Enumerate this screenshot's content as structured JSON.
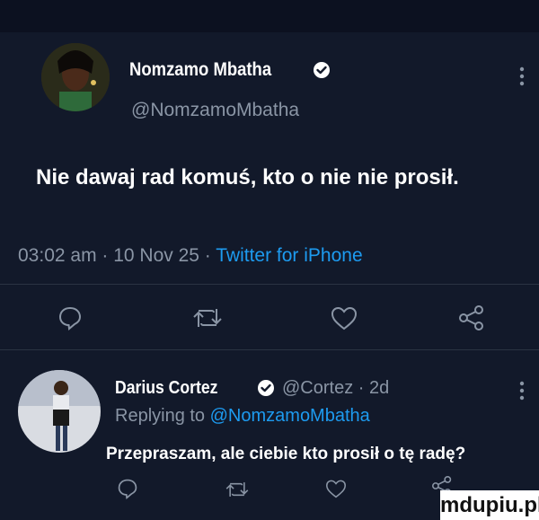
{
  "main_tweet": {
    "author_name": "Nomzamo Mbatha",
    "handle": "@NomzamoMbatha",
    "text": "Nie dawaj rad komuś, kto o nie nie prosił.",
    "timestamp": "03:02 am · 10 Nov 25 · ",
    "source": "Twitter for iPhone",
    "icons": [
      "more-icon",
      "reply-icon",
      "retweet-icon",
      "like-icon",
      "share-icon"
    ]
  },
  "reply_tweet": {
    "author_name": "Darius Cortez",
    "handle_time": "@Cortez · 2d",
    "replying_prefix": "Replying to ",
    "replying_to": "@NomzamoMbatha",
    "text": "Przepraszam, ale ciebie kto prosił o tę radę?",
    "icons": [
      "more-icon",
      "reply-icon",
      "retweet-icon",
      "like-icon",
      "share-icon"
    ]
  },
  "watermark": "mdupiu.pl",
  "colors": {
    "background": "#12192a",
    "muted_text": "#8a95a5",
    "link": "#1d9bf0",
    "verified": "#ffffff"
  }
}
